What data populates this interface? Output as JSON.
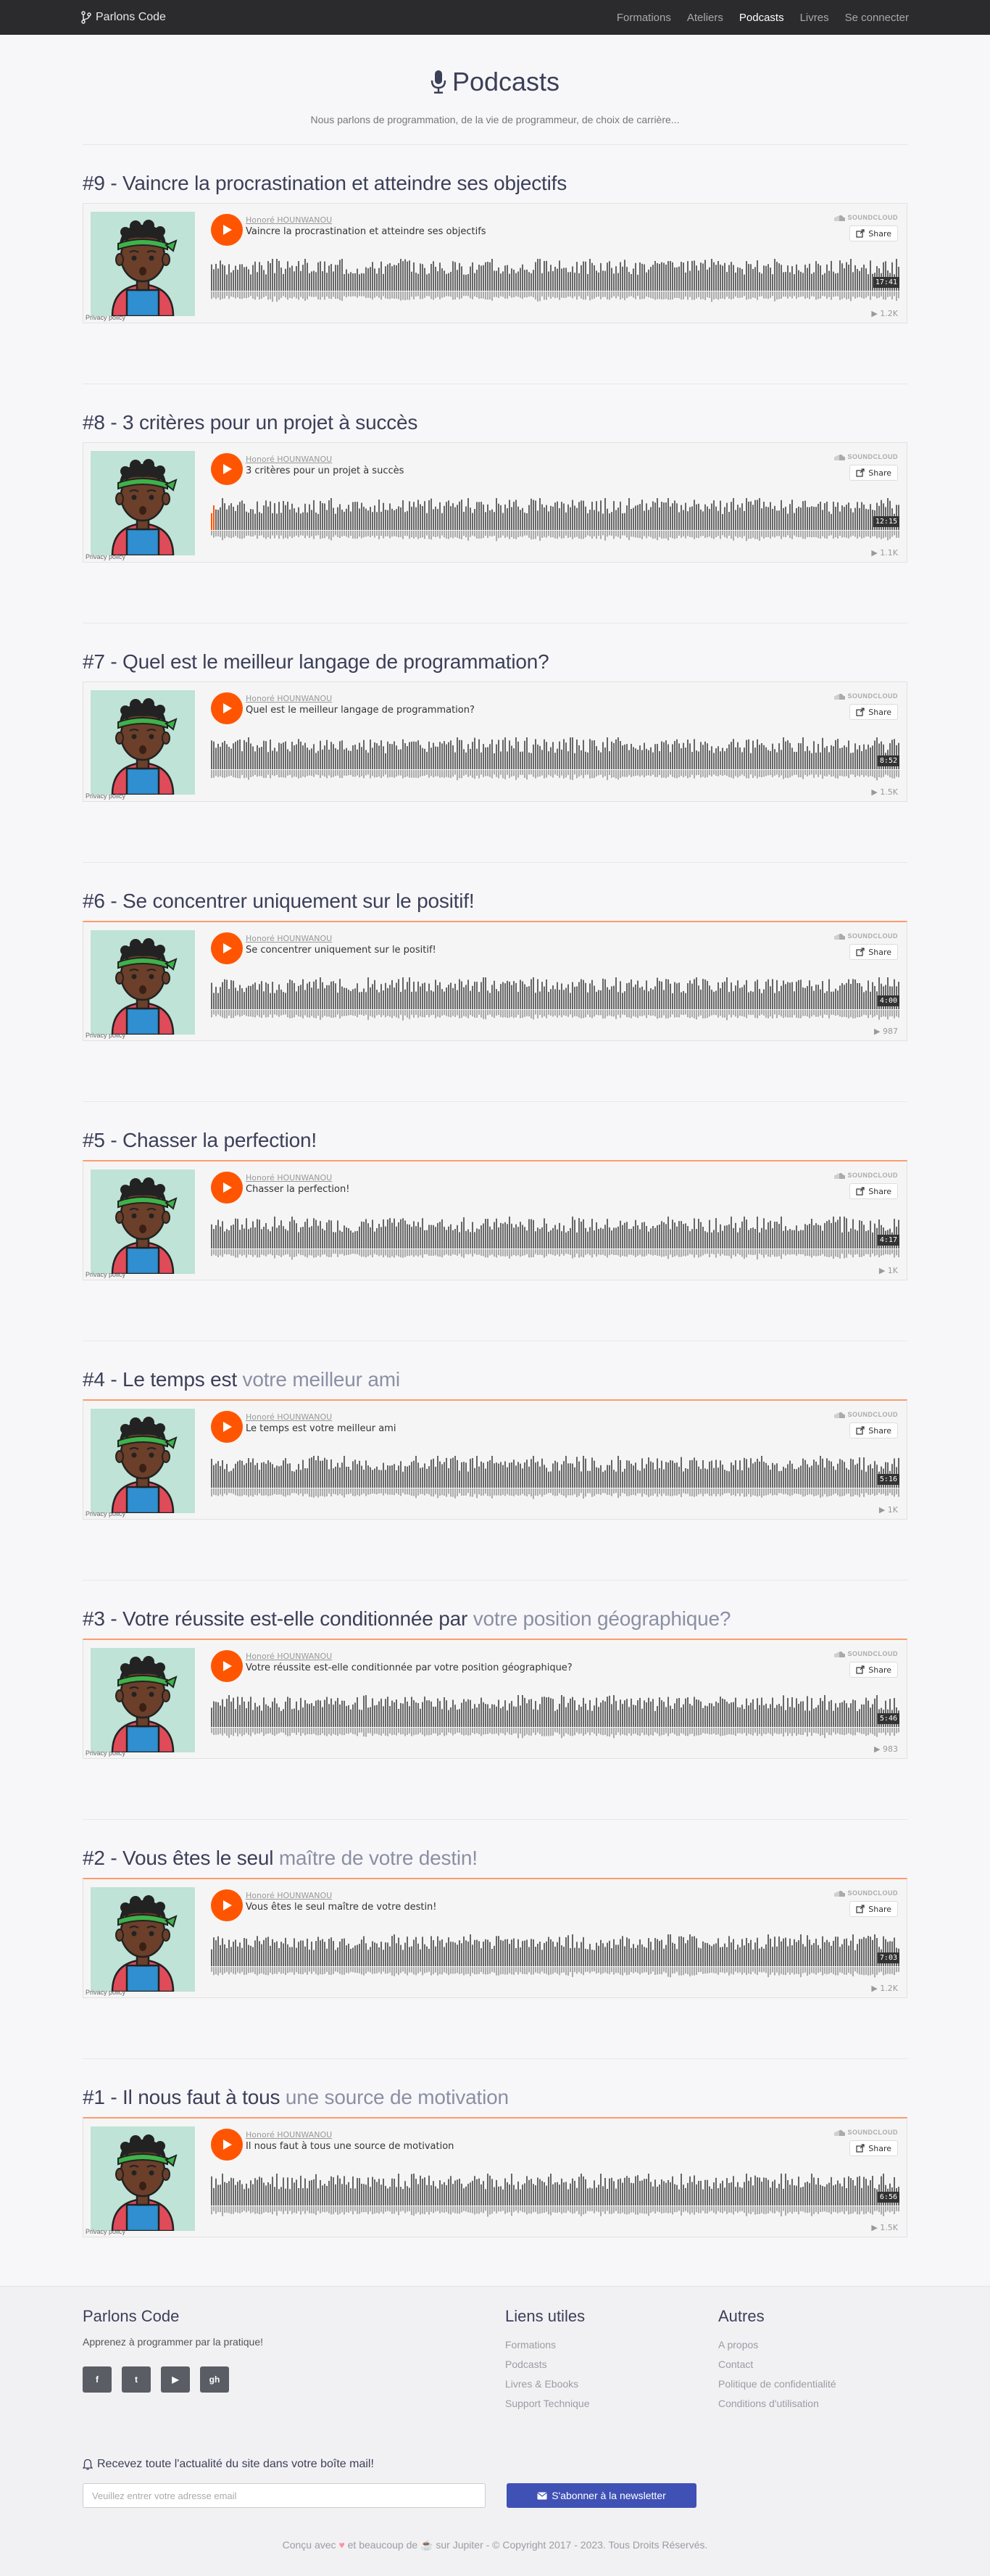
{
  "nav": {
    "brand": "Parlons Code",
    "links": [
      {
        "label": "Formations",
        "active": false
      },
      {
        "label": "Ateliers",
        "active": false
      },
      {
        "label": "Podcasts",
        "active": true
      },
      {
        "label": "Livres",
        "active": false
      },
      {
        "label": "Se connecter",
        "active": false
      }
    ]
  },
  "header": {
    "title": "Podcasts",
    "subtitle": "Nous parlons de programmation, de la vie de programmeur, de choix de carrière..."
  },
  "player_common": {
    "artist": "Honoré HOUNWANOU",
    "soundcloud": "SOUNDCLOUD",
    "share": "Share",
    "privacy": "Privacy policy"
  },
  "episodes": [
    {
      "title_main": "#9 - Vaincre la procrastination et atteindre ses objectifs",
      "title_light": "",
      "track": "Vaincre la procrastination et atteindre ses objectifs",
      "duration": "17:41",
      "plays": "1.2K",
      "orange": false
    },
    {
      "title_main": "#8 - 3 critères pour un projet à succès",
      "title_light": "",
      "track": "3 critères pour un projet à succès",
      "duration": "12:15",
      "plays": "1.1K",
      "orange": false
    },
    {
      "title_main": "#7 - Quel est le meilleur langage de programmation?",
      "title_light": "",
      "track": "Quel est le meilleur langage de programmation?",
      "duration": "8:52",
      "plays": "1.5K",
      "orange": false
    },
    {
      "title_main": "#6 - Se concentrer uniquement sur le positif!",
      "title_light": "",
      "track": "Se concentrer uniquement sur le positif!",
      "duration": "4:00",
      "plays": "987",
      "orange": true
    },
    {
      "title_main": "#5 - Chasser la perfection!",
      "title_light": "",
      "track": "Chasser la perfection!",
      "duration": "4:17",
      "plays": "1K",
      "orange": true
    },
    {
      "title_main": "#4 - Le temps est ",
      "title_light": "votre meilleur ami",
      "track": "Le temps est votre meilleur ami",
      "duration": "5:16",
      "plays": "1K",
      "orange": true
    },
    {
      "title_main": "#3 - Votre réussite est-elle conditionnée par ",
      "title_light": "votre position géographique?",
      "track": "Votre réussite est-elle conditionnée par votre position géographique?",
      "duration": "5:46",
      "plays": "983",
      "orange": true
    },
    {
      "title_main": "#2 - Vous êtes le seul ",
      "title_light": "maître de votre destin!",
      "track": "Vous êtes le seul maître de votre destin!",
      "duration": "7:03",
      "plays": "1.2K",
      "orange": true
    },
    {
      "title_main": "#1 - Il nous faut à tous ",
      "title_light": "une source de motivation",
      "track": "Il nous faut à tous une source de motivation",
      "duration": "6:56",
      "plays": "1.5K",
      "orange": true
    }
  ],
  "footer": {
    "brand": "Parlons Code",
    "tagline": "Apprenez à programmer par la pratique!",
    "socials": [
      {
        "icon": "facebook-icon",
        "glyph": "f"
      },
      {
        "icon": "twitter-icon",
        "glyph": "t"
      },
      {
        "icon": "youtube-icon",
        "glyph": "▶"
      },
      {
        "icon": "github-icon",
        "glyph": "gh"
      }
    ],
    "useful_title": "Liens utiles",
    "useful_links": [
      "Formations",
      "Podcasts",
      "Livres & Ebooks",
      "Support Technique"
    ],
    "other_title": "Autres",
    "other_links": [
      "A propos",
      "Contact",
      "Politique de confidentialité",
      "Conditions d'utilisation"
    ],
    "newsletter_title": "Recevez toute l'actualité du site dans votre boîte mail!",
    "email_placeholder": "Veuillez entrer votre adresse email",
    "subscribe_label": "S'abonner à la newsletter",
    "copyright_before": "Conçu avec",
    "copyright_after": "et beaucoup de ☕ sur Jupiter - © Copyright 2017 - 2023. Tous Droits Réservés."
  },
  "colors": {
    "accent": "#ff5500",
    "brand_button": "#3f51b5",
    "navbar": "#2b2b2d",
    "orange_border": "#ff9b6b"
  }
}
